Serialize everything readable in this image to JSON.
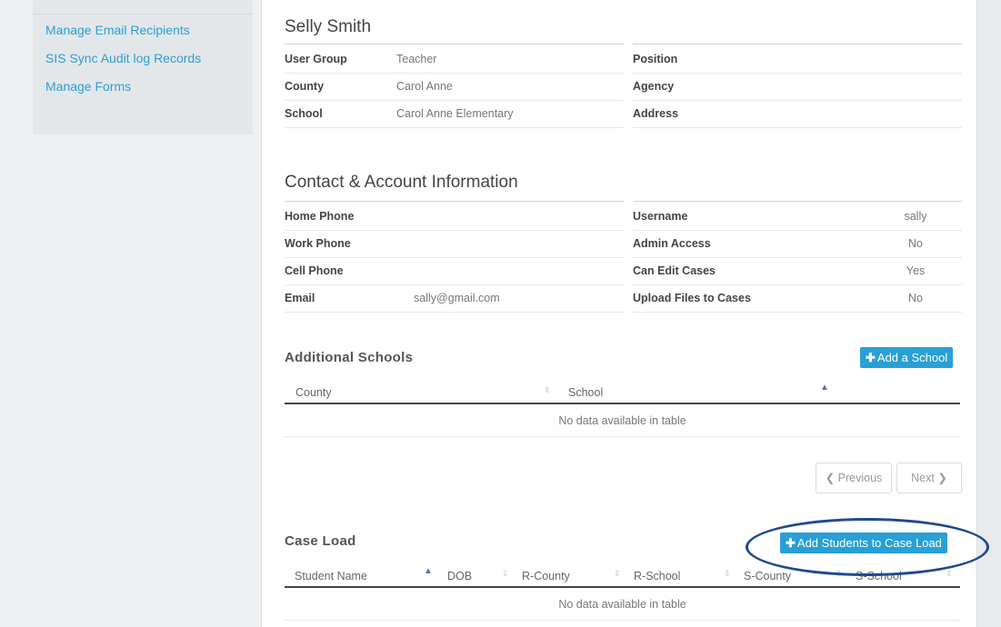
{
  "sidebar": {
    "items": [
      {
        "label": "Manage Email Recipients"
      },
      {
        "label": "SIS Sync Audit log Records"
      },
      {
        "label": "Manage Forms"
      }
    ]
  },
  "profile": {
    "name": "Selly Smith",
    "left": [
      {
        "label": "User Group",
        "value": "Teacher"
      },
      {
        "label": "County",
        "value": "Carol Anne"
      },
      {
        "label": "School",
        "value": "Carol Anne Elementary"
      }
    ],
    "right": [
      {
        "label": "Position",
        "value": ""
      },
      {
        "label": "Agency",
        "value": ""
      },
      {
        "label": "Address",
        "value": ""
      }
    ]
  },
  "contact": {
    "title": "Contact & Account Information",
    "left": [
      {
        "label": "Home Phone",
        "value": ""
      },
      {
        "label": "Work Phone",
        "value": ""
      },
      {
        "label": "Cell Phone",
        "value": ""
      },
      {
        "label": "Email",
        "value": "sally@gmail.com"
      }
    ],
    "right": [
      {
        "label": "Username",
        "value": "sally"
      },
      {
        "label": "Admin Access",
        "value": "No"
      },
      {
        "label": "Can Edit Cases",
        "value": "Yes"
      },
      {
        "label": "Upload Files to Cases",
        "value": "No"
      }
    ]
  },
  "additional_schools": {
    "title": "Additional Schools",
    "add_button": "Add a School",
    "columns": [
      "County",
      "School"
    ],
    "empty_text": "No data available in table",
    "pager": {
      "previous": "Previous",
      "next": "Next"
    }
  },
  "case_load": {
    "title": "Case Load",
    "add_button": "Add Students to Case Load",
    "columns": [
      "Student Name",
      "DOB",
      "R-County",
      "R-School",
      "S-County",
      "S-School"
    ],
    "empty_text": "No data available in table"
  },
  "colors": {
    "accent": "#2a9fd6",
    "highlight_oval": "#1f4a8c"
  }
}
